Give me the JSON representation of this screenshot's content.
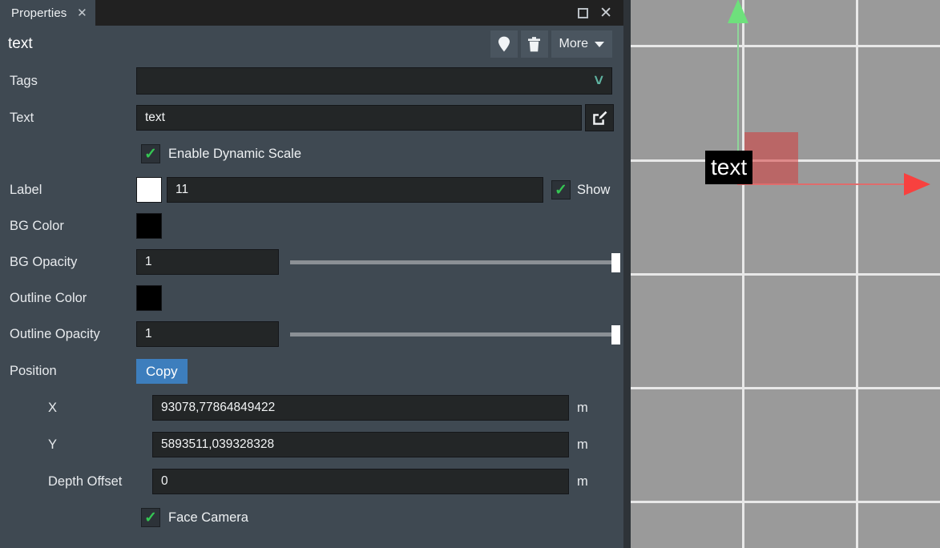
{
  "window": {
    "tab_label": "Properties",
    "tab_close_icon": "close-icon",
    "maximize_icon": "maximize-icon",
    "close_icon": "close-icon"
  },
  "header": {
    "object_name": "text",
    "pin_icon": "map-pin-icon",
    "delete_icon": "trash-icon",
    "more_label": "More",
    "more_caret_icon": "chevron-down-icon"
  },
  "form": {
    "tags": {
      "label": "Tags",
      "value": "",
      "placeholder": "",
      "chevron_icon": "chevron-down-icon"
    },
    "text": {
      "label": "Text",
      "value": "text",
      "edit_icon": "edit-pencil-icon"
    },
    "dynamic_scale": {
      "label": "Enable Dynamic Scale",
      "checked": true,
      "check_icon": "check-icon"
    },
    "label_row": {
      "label": "Label",
      "color": "#ffffff",
      "value": "11",
      "show_label": "Show",
      "show_checked": true,
      "check_icon": "check-icon"
    },
    "bg_color": {
      "label": "BG Color",
      "color": "#000000"
    },
    "bg_opacity": {
      "label": "BG Opacity",
      "value": "1",
      "slider_percent": 100
    },
    "outline_color": {
      "label": "Outline Color",
      "color": "#000000"
    },
    "outline_opacity": {
      "label": "Outline Opacity",
      "value": "1",
      "slider_percent": 100
    },
    "position": {
      "label": "Position",
      "copy_label": "Copy",
      "x": {
        "label": "X",
        "value": "93078,77864849422",
        "unit": "m"
      },
      "y": {
        "label": "Y",
        "value": "5893511,039328328",
        "unit": "m"
      },
      "depth_offset": {
        "label": "Depth Offset",
        "value": "0",
        "unit": "m"
      }
    },
    "face_camera": {
      "label": "Face Camera",
      "checked": true,
      "check_icon": "check-icon"
    }
  },
  "viewport": {
    "label_text": "text",
    "background_color": "#9a9a9a",
    "grid_color": "#e8e8e8",
    "y_axis_color": "#6ee07c",
    "x_axis_color": "#f8413f",
    "handle_color": "#d63c3c"
  },
  "colors": {
    "panel_bg": "#3f4952",
    "titlebar_bg": "#212121",
    "field_bg": "#232627",
    "accent_blue": "#3d7ebd",
    "check_green": "#35c653",
    "chevron_teal": "#5fb3a1"
  }
}
